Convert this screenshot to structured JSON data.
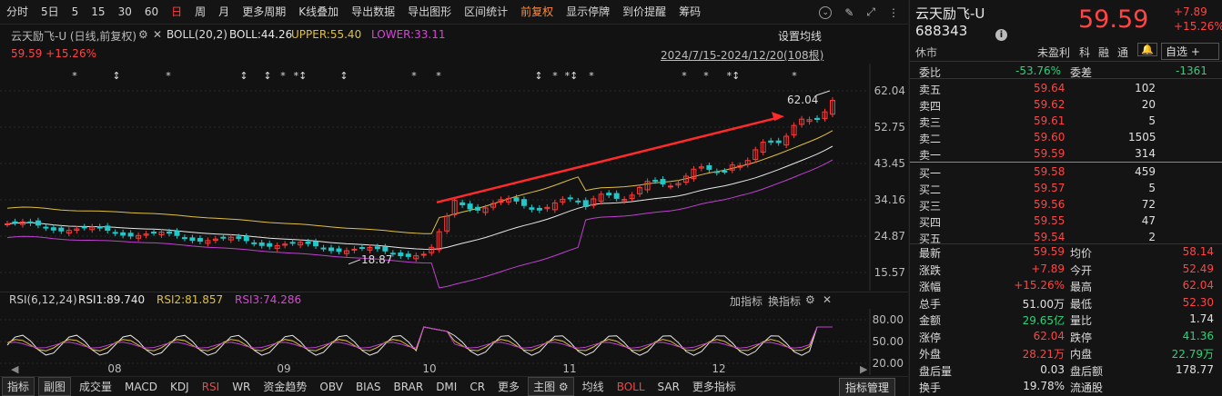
{
  "toolbar": {
    "items": [
      "分时",
      "5日",
      "5",
      "15",
      "30",
      "60",
      "日",
      "周",
      "月",
      "更多周期",
      "K线叠加",
      "导出数据",
      "导出图形",
      "区间统计",
      "前复权",
      "显示停牌",
      "到价提醒",
      "筹码"
    ],
    "active_index": 6,
    "accent_index": 14
  },
  "indicator_header": {
    "title": "云天励飞-U (日线,前复权)",
    "boll_name": "BOLL(20,2)",
    "boll_mid": "BOLL:44.26",
    "upper": "UPPER:55.40",
    "lower": "LOWER:33.11",
    "setting": "设置均线",
    "price_line": "59.59 +15.26%",
    "range": "2024/7/15-2024/12/20(108根)"
  },
  "chart_data": {
    "type": "candlestick",
    "y_ticks": [
      "62.04",
      "52.75",
      "43.45",
      "34.16",
      "24.87",
      "15.57"
    ],
    "x_ticks": [
      "08",
      "09",
      "10",
      "11",
      "12"
    ],
    "annotations": {
      "high": "62.04",
      "low": "18.87"
    },
    "series": [
      {
        "name": "BOLL",
        "color": "#e8e8e8"
      },
      {
        "name": "UPPER",
        "color": "#e0c040"
      },
      {
        "name": "LOWER",
        "color": "#c040d0"
      }
    ]
  },
  "rsi": {
    "name": "RSI(6,12,24)",
    "rsi1": "RSI1:89.740",
    "rsi2": "RSI2:81.857",
    "rsi3": "RSI3:74.286",
    "add": "加指标",
    "switch": "换指标",
    "y_ticks": [
      "80.00",
      "50.00",
      "20.00"
    ]
  },
  "bottom_tabs": {
    "items": [
      "指标",
      "副图",
      "成交量",
      "MACD",
      "KDJ",
      "RSI",
      "WR",
      "资金趋势",
      "OBV",
      "BIAS",
      "BRAR",
      "DMI",
      "CR",
      "更多",
      "主图",
      "均线",
      "BOLL",
      "SAR",
      "更多指标"
    ],
    "manager": "指标管理"
  },
  "quote": {
    "name": "云天励飞-U",
    "code": "688343",
    "price": "59.59",
    "change": "+7.89",
    "change_pct": "+15.26%",
    "status": "休市",
    "tags": [
      "未盈利",
      "科",
      "融",
      "通"
    ],
    "watch": "自选 +",
    "weibi_label": "委比",
    "weibi": "-53.76%",
    "weicha_label": "委差",
    "weicha": "-1361",
    "asks": [
      {
        "label": "卖五",
        "price": "59.64",
        "vol": "102"
      },
      {
        "label": "卖四",
        "price": "59.62",
        "vol": "20"
      },
      {
        "label": "卖三",
        "price": "59.61",
        "vol": "5"
      },
      {
        "label": "卖二",
        "price": "59.60",
        "vol": "1505"
      },
      {
        "label": "卖一",
        "price": "59.59",
        "vol": "314"
      }
    ],
    "bids": [
      {
        "label": "买一",
        "price": "59.58",
        "vol": "459"
      },
      {
        "label": "买二",
        "price": "59.57",
        "vol": "5"
      },
      {
        "label": "买三",
        "price": "59.56",
        "vol": "72"
      },
      {
        "label": "买四",
        "price": "59.55",
        "vol": "47"
      },
      {
        "label": "买五",
        "price": "59.54",
        "vol": "2"
      }
    ],
    "stats": [
      {
        "l1": "最新",
        "v1": "59.59",
        "c1": "red",
        "l2": "均价",
        "v2": "58.14",
        "c2": "red"
      },
      {
        "l1": "涨跌",
        "v1": "+7.89",
        "c1": "red",
        "l2": "今开",
        "v2": "52.49",
        "c2": "red"
      },
      {
        "l1": "涨幅",
        "v1": "+15.26%",
        "c1": "red",
        "l2": "最高",
        "v2": "62.04",
        "c2": "red"
      },
      {
        "l1": "总手",
        "v1": "51.00万",
        "c1": "white",
        "l2": "最低",
        "v2": "52.30",
        "c2": "red"
      },
      {
        "l1": "金额",
        "v1": "29.65亿",
        "c1": "green",
        "l2": "量比",
        "v2": "1.74",
        "c2": "white"
      },
      {
        "l1": "涨停",
        "v1": "62.04",
        "c1": "red",
        "l2": "跌停",
        "v2": "41.36",
        "c2": "green"
      },
      {
        "l1": "外盘",
        "v1": "28.21万",
        "c1": "red",
        "l2": "内盘",
        "v2": "22.79万",
        "c2": "green"
      },
      {
        "l1": "盘后量",
        "v1": "0.03",
        "c1": "white",
        "l2": "盘后额",
        "v2": "178.77",
        "c2": "white"
      },
      {
        "l1": "换手",
        "v1": "19.78%",
        "c1": "white",
        "l2": "流通股",
        "v2": "",
        "c2": "white"
      }
    ]
  }
}
